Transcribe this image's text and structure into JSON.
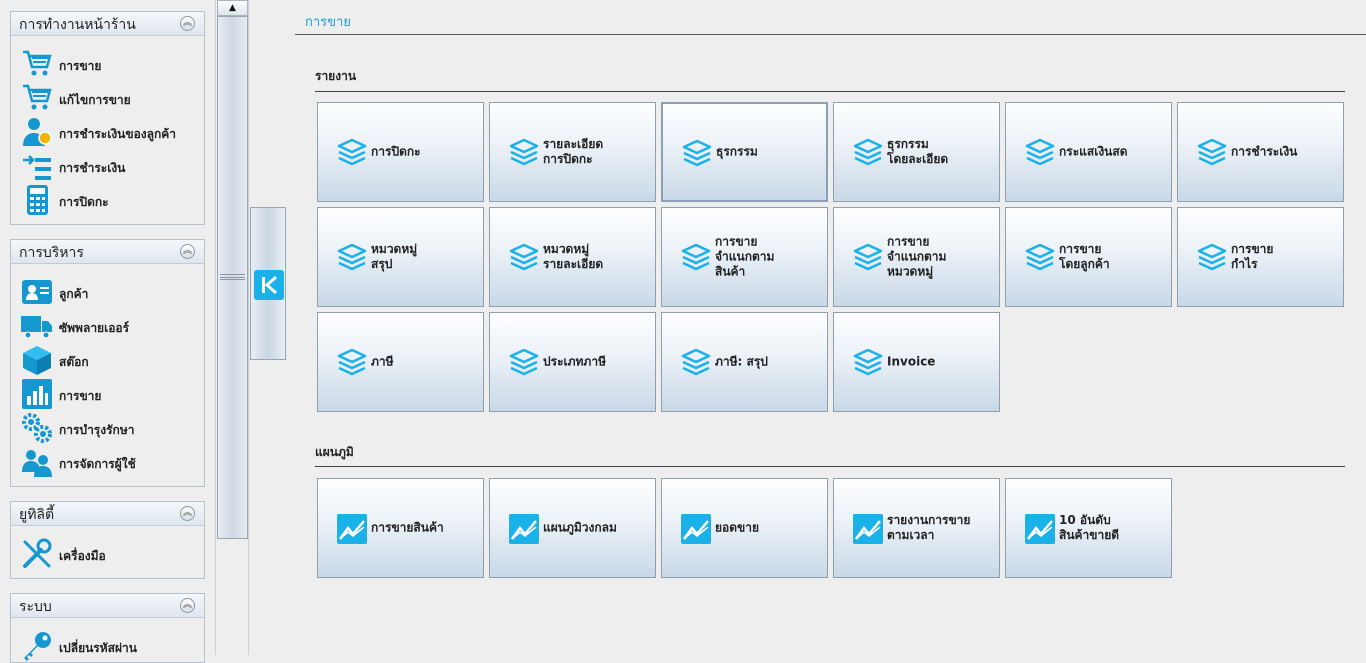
{
  "sidebar": {
    "front_office": {
      "title": "การทำงานหน้าร้าน",
      "items": [
        {
          "label": "การขาย",
          "icon": "shopping-cart-icon"
        },
        {
          "label": "แก้ไขการขาย",
          "icon": "shopping-cart-icon"
        },
        {
          "label": "การชำระเงินของลูกค้า",
          "icon": "customer-payment-icon"
        },
        {
          "label": "การชำระเงิน",
          "icon": "payment-arrow-icon"
        },
        {
          "label": "การปิดกะ",
          "icon": "calculator-icon"
        }
      ]
    },
    "management": {
      "title": "การบริหาร",
      "items": [
        {
          "label": "ลูกค้า",
          "icon": "customer-card-icon"
        },
        {
          "label": "ซัพพลายเออร์",
          "icon": "truck-icon"
        },
        {
          "label": "สต๊อก",
          "icon": "box-icon"
        },
        {
          "label": "การขาย",
          "icon": "bar-chart-icon"
        },
        {
          "label": "การบำรุงรักษา",
          "icon": "gears-icon"
        },
        {
          "label": "การจัดการผู้ใช้",
          "icon": "users-icon"
        }
      ]
    },
    "utilities": {
      "title": "ยูทิลิตี้",
      "items": [
        {
          "label": "เครื่องมือ",
          "icon": "tools-icon"
        }
      ]
    },
    "system": {
      "title": "ระบบ",
      "items": [
        {
          "label": "เปลี่ยนรหัสผ่าน",
          "icon": "key-icon"
        }
      ]
    }
  },
  "page": {
    "title": "การขาย",
    "reports_title": "รายงาน",
    "charts_title": "แผนภูมิ"
  },
  "reports": [
    {
      "label": "การปิดกะ"
    },
    {
      "label": "รายละเอียด\nการปิดกะ"
    },
    {
      "label": "ธุรกรรม"
    },
    {
      "label": "ธุรกรรม\nโดยละเอียด"
    },
    {
      "label": "กระแสเงินสด"
    },
    {
      "label": "การชำระเงิน"
    },
    {
      "label": "หมวดหมู่\nสรุป"
    },
    {
      "label": "หมวดหมู่\nรายละเอียด"
    },
    {
      "label": "การขาย\nจำแนกตาม\nสินค้า"
    },
    {
      "label": "การขาย\nจำแนกตาม\nหมวดหมู่"
    },
    {
      "label": "การขาย\nโดยลูกค้า"
    },
    {
      "label": "การขาย\nกำไร"
    },
    {
      "label": "ภาษี"
    },
    {
      "label": "ประเภทภาษี"
    },
    {
      "label": "ภาษี: สรุป"
    },
    {
      "label": "Invoice"
    }
  ],
  "charts": [
    {
      "label": "การขายสินค้า"
    },
    {
      "label": "แผนภูมิวงกลม"
    },
    {
      "label": "ยอดขาย"
    },
    {
      "label": "รายงานการขาย\nตามเวลา"
    },
    {
      "label": "10 อันดับ\nสินค้าขายดี"
    }
  ],
  "colors": {
    "accent": "#1ab0e8",
    "title": "#1a9fd8"
  },
  "scroll": {
    "up_arrow": "▲"
  },
  "selected_report_index": 2
}
